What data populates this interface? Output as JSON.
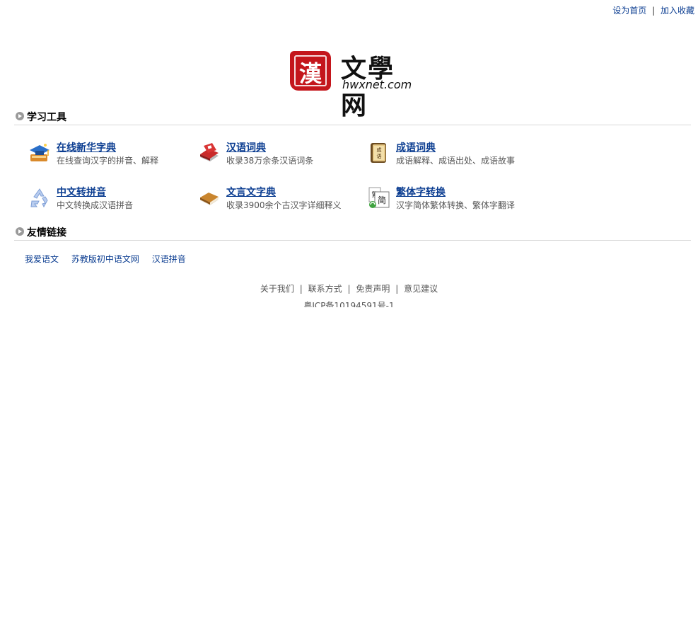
{
  "top_links": {
    "set_home": "设为首页",
    "separator": "|",
    "add_favorite": "加入收藏"
  },
  "logo": {
    "seal_char": "漢",
    "title": "文學网",
    "domain": "hwxnet.com"
  },
  "sections": {
    "tools_title": "学习工具",
    "links_title": "友情链接"
  },
  "tools": [
    {
      "name": "在线新华字典",
      "desc": "在线查询汉字的拼音、解释",
      "icon": "graduation-cap-icon"
    },
    {
      "name": "汉语词典",
      "desc": "收录38万余条汉语词条",
      "icon": "red-book-icon"
    },
    {
      "name": "成语词典",
      "desc": "成语解释、成语出处、成语故事",
      "icon": "scroll-book-icon"
    },
    {
      "name": "中文转拼音",
      "desc": "中文转换成汉语拼音",
      "icon": "recycle-icon"
    },
    {
      "name": "文言文字典",
      "desc": "收录3900余个古汉字详细释义",
      "icon": "brown-book-icon"
    },
    {
      "name": "繁体字转换",
      "desc": "汉字简体繁体转换、繁体字翻译",
      "icon": "simplified-traditional-icon"
    }
  ],
  "friend_links": [
    "我爱语文",
    "苏教版初中语文网",
    "汉语拼音"
  ],
  "footer": {
    "links": [
      "关于我们",
      "联系方式",
      "免责声明",
      "意见建议"
    ],
    "separator": "|",
    "icp": "粤ICP备10194591号-1"
  },
  "colors": {
    "link": "#0b3d91",
    "seal": "#c4161c",
    "divider": "#d8d8d8"
  }
}
